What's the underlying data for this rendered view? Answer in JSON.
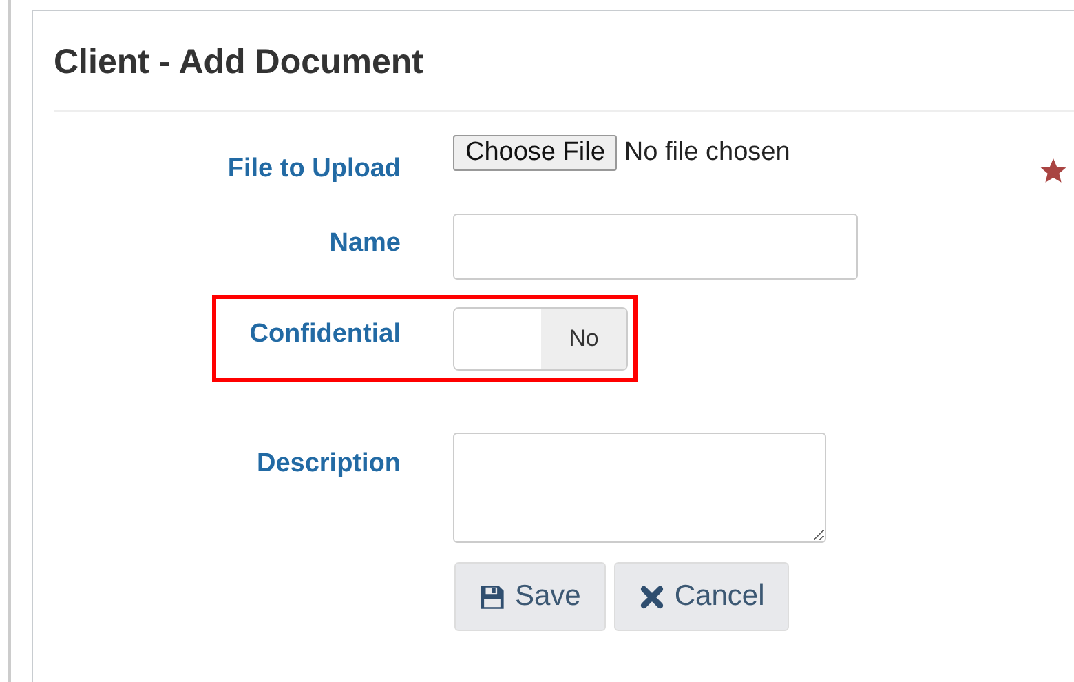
{
  "panel": {
    "title": "Client - Add Document"
  },
  "fields": [
    {
      "kind": "file",
      "label": "File to Upload",
      "button": "Choose File",
      "status": "No file chosen",
      "required": true
    },
    {
      "kind": "text",
      "label": "Name"
    },
    {
      "kind": "toggle",
      "label": "Confidential",
      "on": false,
      "state_label": "No",
      "highlighted": true
    },
    {
      "kind": "textarea",
      "label": "Description"
    }
  ],
  "buttons": [
    {
      "kind": "save",
      "label": "Save"
    },
    {
      "kind": "cancel",
      "label": "Cancel"
    }
  ]
}
